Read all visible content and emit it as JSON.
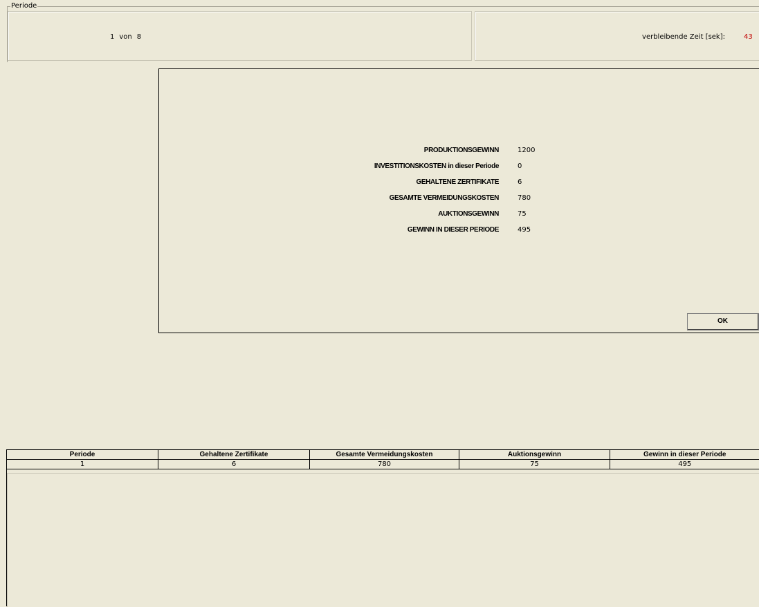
{
  "header": {
    "group_label": "Periode",
    "period_current": "1",
    "period_sep": "von",
    "period_total": "8",
    "time_label": "verbleibende Zeit [sek]:",
    "time_value": "43",
    "time_color": "#c00000"
  },
  "results": {
    "rows": [
      {
        "label": "PRODUKTIONSGEWINN",
        "value": "1200"
      },
      {
        "label": "INVESTITIONSKOSTEN in dieser Periode",
        "value": "0"
      },
      {
        "label": "GEHALTENE ZERTIFIKATE",
        "value": "6"
      },
      {
        "label": "GESAMTE VERMEIDUNGSKOSTEN",
        "value": "780"
      },
      {
        "label": "AUKTIONSGEWINN",
        "value": "75"
      },
      {
        "label": "GEWINN IN DIESER PERIODE",
        "value": "495"
      }
    ],
    "ok_label": "OK"
  },
  "history": {
    "columns": [
      "Periode",
      "Gehaltene Zertifikate",
      "Gesamte Vermeidungskosten",
      "Auktionsgewinn",
      "Gewinn in dieser Periode"
    ],
    "rows": [
      [
        "1",
        "6",
        "780",
        "75",
        "495"
      ]
    ]
  }
}
